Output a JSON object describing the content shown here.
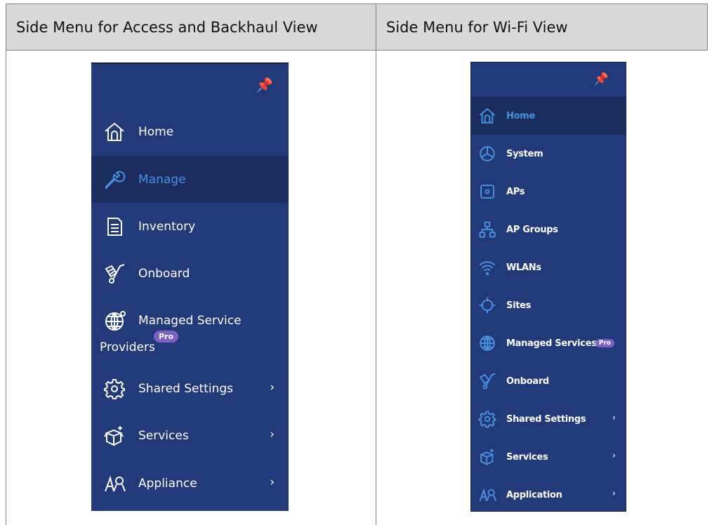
{
  "table": {
    "headers": [
      "Side Menu for Access and Backhaul View",
      "Side Menu for Wi-Fi View"
    ]
  },
  "access_menu": {
    "items": [
      {
        "label": "Home",
        "icon": "home-icon"
      },
      {
        "label": "Manage",
        "icon": "wrench-icon",
        "active": true
      },
      {
        "label": "Inventory",
        "icon": "document-icon"
      },
      {
        "label": "Onboard",
        "icon": "hand-truck-icon"
      },
      {
        "label": "Shared Settings",
        "icon": "gear-icon",
        "chevron": "›"
      },
      {
        "label": "Services",
        "icon": "services-box-icon",
        "chevron": "›"
      },
      {
        "label": "Appliance",
        "icon": "appliance-icon",
        "chevron": "›"
      }
    ],
    "msp": {
      "line1": "Managed Service",
      "line2": "Providers",
      "badge": "Pro",
      "icon": "globe-icon"
    }
  },
  "wifi_menu": {
    "items": [
      {
        "label": "Home",
        "icon": "home-icon",
        "active": true
      },
      {
        "label": "System",
        "icon": "system-icon"
      },
      {
        "label": "APs",
        "icon": "ap-icon"
      },
      {
        "label": "AP Groups",
        "icon": "ap-groups-icon"
      },
      {
        "label": "WLANs",
        "icon": "wifi-icon"
      },
      {
        "label": "Sites",
        "icon": "sites-icon"
      },
      {
        "label": "Managed Services",
        "icon": "globe-icon",
        "badge": "Pro"
      },
      {
        "label": "Onboard",
        "icon": "hand-truck-icon"
      },
      {
        "label": "Shared Settings",
        "icon": "gear-icon",
        "chevron": "›"
      },
      {
        "label": "Services",
        "icon": "services-box-icon",
        "chevron": "›"
      },
      {
        "label": "Application",
        "icon": "appliance-icon",
        "chevron": "›"
      }
    ]
  },
  "colors": {
    "menu_bg": "#22397a",
    "active_bg": "#1a2d5e",
    "active_text": "#4a90e2",
    "badge": "#7b61c4",
    "header_bg": "#d9d9d9"
  }
}
